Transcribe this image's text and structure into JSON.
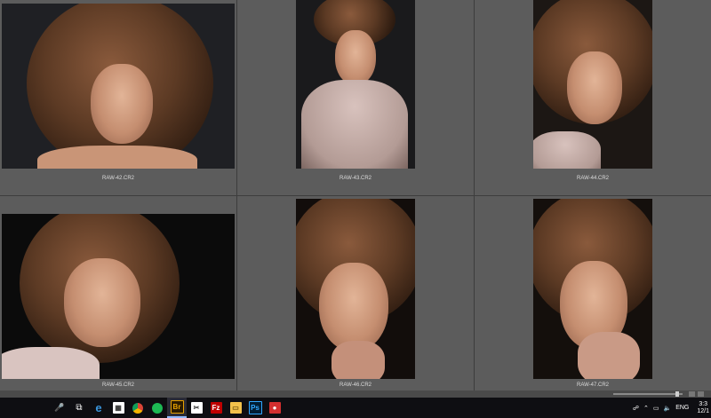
{
  "thumbnails": [
    {
      "filename": "RAW-42.CR2"
    },
    {
      "filename": "RAW-43.CR2"
    },
    {
      "filename": "RAW-44.CR2"
    },
    {
      "filename": "RAW-45.CR2"
    },
    {
      "filename": "RAW-46.CR2"
    },
    {
      "filename": "RAW-47.CR2"
    }
  ],
  "taskbar": {
    "icons": [
      {
        "name": "microphone-icon",
        "glyph": "🎤"
      },
      {
        "name": "task-view-icon",
        "glyph": "⧉"
      },
      {
        "name": "edge-icon",
        "glyph": "e"
      },
      {
        "name": "store-icon",
        "glyph": "🛍"
      },
      {
        "name": "chrome-icon",
        "glyph": "◉"
      },
      {
        "name": "spotify-icon",
        "glyph": "◐"
      },
      {
        "name": "bridge-icon",
        "glyph": "Br"
      },
      {
        "name": "snipping-icon",
        "glyph": "✂"
      },
      {
        "name": "filezilla-icon",
        "glyph": "Fz"
      },
      {
        "name": "explorer-icon",
        "glyph": "📁"
      },
      {
        "name": "photoshop-icon",
        "glyph": "Ps"
      },
      {
        "name": "camera-icon",
        "glyph": "●"
      }
    ],
    "language": "ENG",
    "time": "3:3",
    "date": "12/1"
  },
  "colors": {
    "grid_bg": "#5c5c5c",
    "taskbar_bg": "#0e0e12",
    "bridge_accent": "#e8a200",
    "photoshop_accent": "#31a8ff",
    "filezilla_accent": "#bf0000"
  }
}
